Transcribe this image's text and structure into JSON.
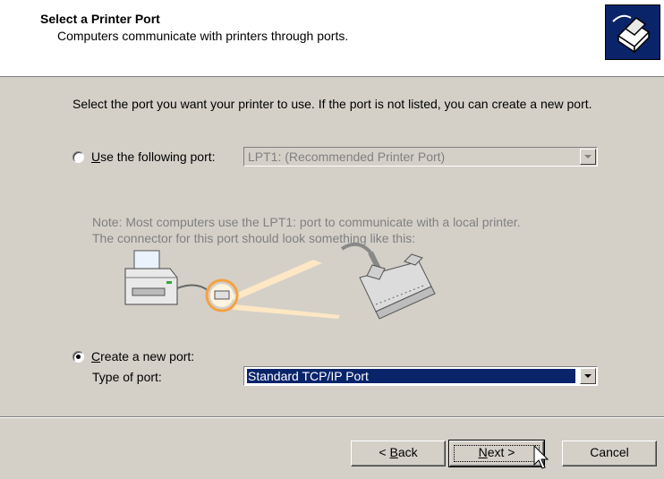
{
  "header": {
    "title": "Select a Printer Port",
    "subtitle": "Computers communicate with printers through ports.",
    "icon": "printer-port-icon"
  },
  "intro_text": "Select the port you want your printer to use.  If the port is not listed, you can create a new port.",
  "use_port": {
    "label_u": "U",
    "label_rest": "se the following port:",
    "checked": false,
    "value": "LPT1: (Recommended Printer Port)"
  },
  "note": {
    "line1": "Note: Most computers use the LPT1: port to communicate with a local printer.",
    "line2": "The connector for this port should look something like this:"
  },
  "create_port": {
    "label_u": "C",
    "label_rest": "reate a new port:",
    "checked": true,
    "type_label": "Type of port:",
    "type_value": "Standard TCP/IP Port"
  },
  "buttons": {
    "back_prefix": "< ",
    "back_u": "B",
    "back_rest": "ack",
    "next_u": "N",
    "next_rest": "ext >",
    "cancel": "Cancel"
  },
  "colors": {
    "dialog_bg": "#d4d0c8",
    "selection": "#0a246a",
    "highlight_ring": "#f5a142"
  }
}
